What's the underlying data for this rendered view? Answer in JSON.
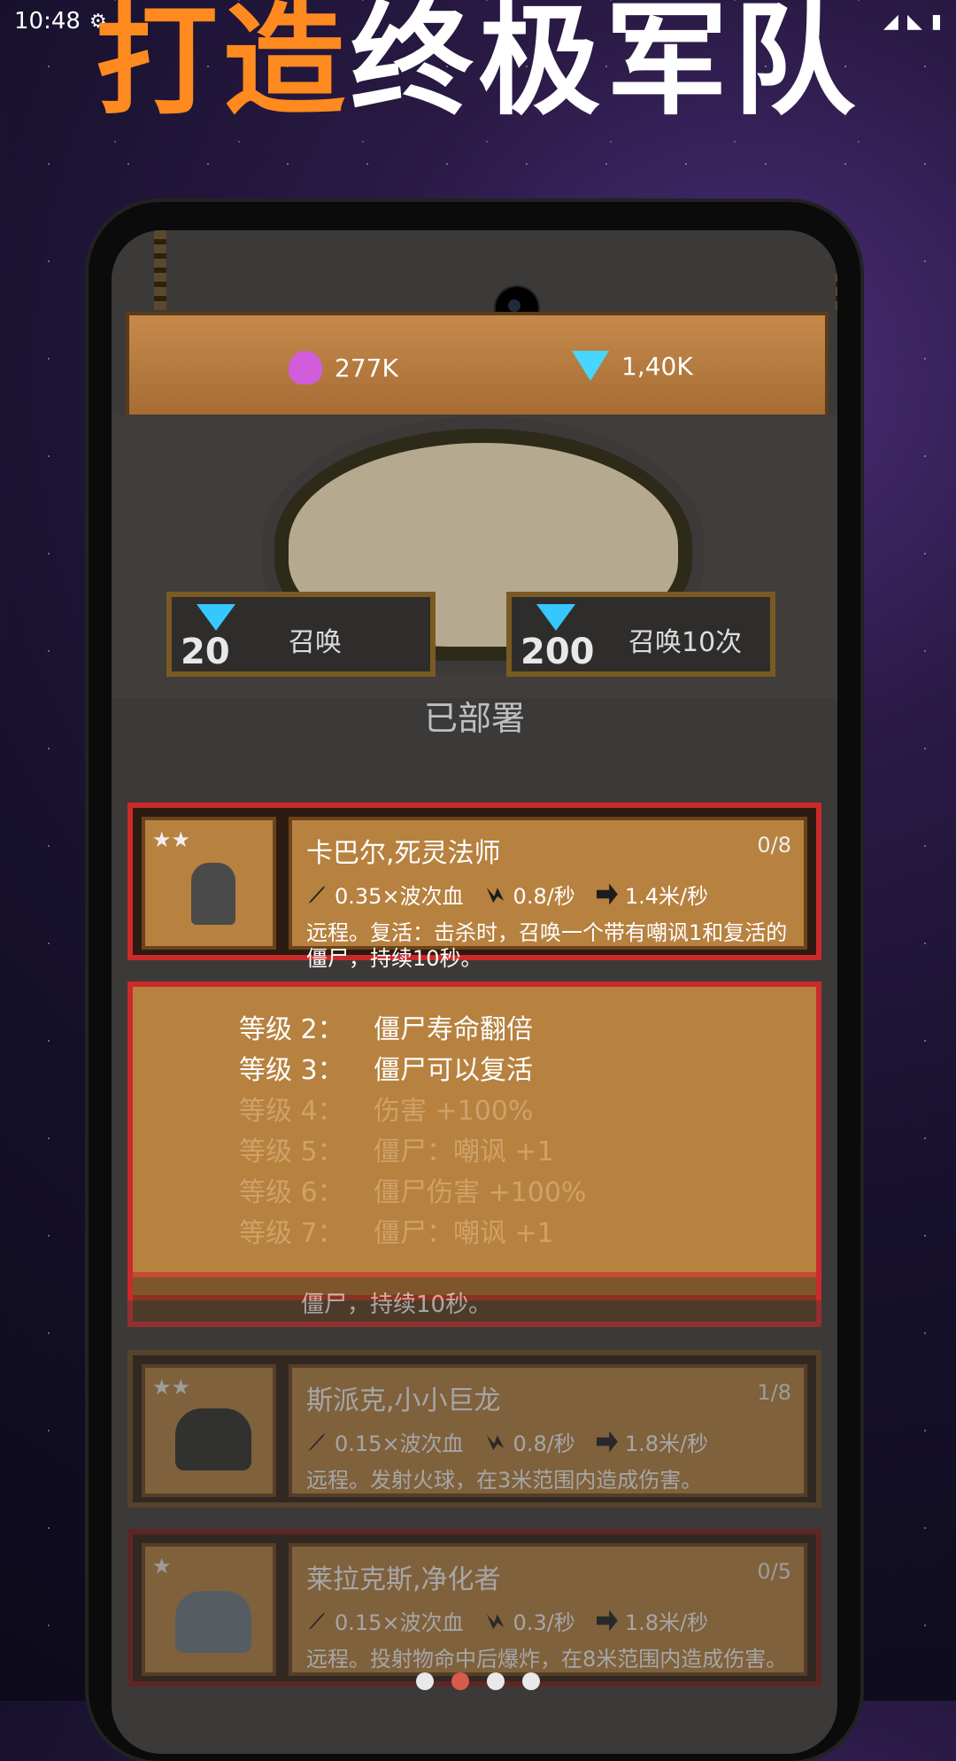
{
  "status": {
    "time": "10:48",
    "carrier_icon": "bug-icon"
  },
  "promo": {
    "title_orange": "打造",
    "title_white": "终极军队"
  },
  "resources": {
    "elixir": "277K",
    "gems": "1,40K"
  },
  "summon": {
    "single": {
      "cost": "20",
      "label": "召唤"
    },
    "ten": {
      "cost": "200",
      "label": "召唤10次"
    }
  },
  "deployed_label": "已部署",
  "active_unit": {
    "name": "卡巴尔,死灵法师",
    "count": "0/8",
    "damage": "0.35×波次血",
    "attack_speed": "0.8/秒",
    "move_speed": "1.4米/秒",
    "desc": "远程。复活：击杀时，召唤一个带有嘲讽1和复活的僵尸，持续10秒。"
  },
  "upgrades": [
    {
      "level": "等级 2：",
      "text": "僵尸寿命翻倍",
      "state": "done"
    },
    {
      "level": "等级 3：",
      "text": "僵尸可以复活",
      "state": "done"
    },
    {
      "level": "等级 4：",
      "text": "伤害 +100%",
      "state": "locked"
    },
    {
      "level": "等级 5：",
      "text": "僵尸：嘲讽 +1",
      "state": "locked"
    },
    {
      "level": "等级 6：",
      "text": "僵尸伤害 +100%",
      "state": "locked"
    },
    {
      "level": "等级 7：",
      "text": "僵尸：嘲讽 +1",
      "state": "locked"
    }
  ],
  "overlap_text": "僵尸，持续10秒。",
  "units": [
    {
      "name": "斯派克,小小巨龙",
      "count": "1/8",
      "damage": "0.15×波次血",
      "attack_speed": "0.8/秒",
      "move_speed": "1.8米/秒",
      "desc": "远程。发射火球，在3米范围内造成伤害。",
      "stars": "★★"
    },
    {
      "name": "莱拉克斯,净化者",
      "count": "0/5",
      "damage": "0.15×波次血",
      "attack_speed": "0.3/秒",
      "move_speed": "1.8米/秒",
      "desc": "远程。投射物命中后爆炸，在8米范围内造成伤害。",
      "stars": "★"
    }
  ],
  "pager": {
    "active_index": 1
  }
}
